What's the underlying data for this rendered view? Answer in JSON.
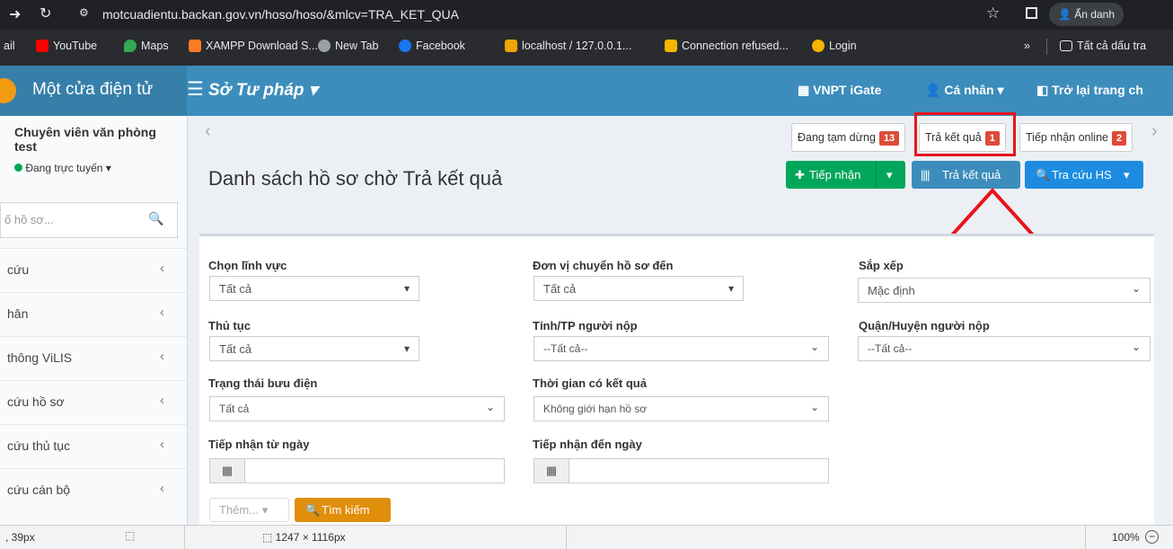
{
  "browser": {
    "url": "motcuadientu.backan.gov.vn/hoso/hoso/&mlcv=TRA_KET_QUA",
    "incognito_label": "Ẩn danh",
    "bookmarks": [
      {
        "label": "ail",
        "color": ""
      },
      {
        "label": "YouTube",
        "color": "#ff0000"
      },
      {
        "label": "Maps",
        "color": "#34a853"
      },
      {
        "label": "XAMPP Download S...",
        "color": "#fb7a24"
      },
      {
        "label": "New Tab",
        "color": "#9aa0a6"
      },
      {
        "label": "Facebook",
        "color": "#1877f2"
      },
      {
        "label": "localhost / 127.0.0.1...",
        "color": "#f0a30a"
      },
      {
        "label": "Connection refused...",
        "color": "#f4b400"
      },
      {
        "label": "Login",
        "color": "#f4b400"
      }
    ],
    "more_label": "»",
    "all_bookmarks_label": "Tất cả dấu tra"
  },
  "app": {
    "logo_text": "Một cửa điện tử",
    "department": "Sở Tư pháp",
    "nav": {
      "vnpt": "VNPT iGate",
      "personal": "Cá nhân",
      "back": "Trở lại trang ch"
    }
  },
  "user": {
    "name": "Chuyên viên văn phòng test",
    "status": "Đang trực tuyến"
  },
  "sidebar": {
    "search_placeholder": "ố hồ sơ...",
    "items": [
      {
        "label": "cứu"
      },
      {
        "label": "hân"
      },
      {
        "label": "thông ViLIS"
      },
      {
        "label": "cứu hồ sơ"
      },
      {
        "label": "cứu thủ tục"
      },
      {
        "label": "cứu cán bộ"
      }
    ]
  },
  "tabs": [
    {
      "label": "Đang tạm dừng",
      "count": "13"
    },
    {
      "label": "Trả kết quả",
      "count": "1"
    },
    {
      "label": "Tiếp nhận online",
      "count": "2"
    }
  ],
  "page": {
    "title": "Danh sách hồ sơ chờ Trả kết quả"
  },
  "actions": {
    "receive": "Tiếp nhận",
    "return": "Trả kết quả",
    "lookup": "Tra cứu HS"
  },
  "filters": {
    "field": {
      "label": "Chọn lĩnh vực",
      "value": "Tất cả"
    },
    "unit": {
      "label": "Đơn vị chuyển hồ sơ đến",
      "value": "Tất cả"
    },
    "sort": {
      "label": "Sắp xếp",
      "value": "Mặc định"
    },
    "procedure": {
      "label": "Thủ tục",
      "value": "Tất cả"
    },
    "province": {
      "label": "Tỉnh/TP người nộp",
      "value": "--Tất cả--"
    },
    "district": {
      "label": "Quận/Huyện người nộp",
      "value": "--Tất cả--"
    },
    "post_status": {
      "label": "Trạng thái bưu điện",
      "value": "Tất cả"
    },
    "result_time": {
      "label": "Thời gian có kết quả",
      "value": "Không giới hạn hồ sơ"
    },
    "from_date": {
      "label": "Tiếp nhận từ ngày"
    },
    "to_date": {
      "label": "Tiếp nhận đến ngày"
    },
    "more": "Thêm...",
    "search": "Tìm kiếm"
  },
  "status": {
    "coords": ", 39px",
    "dims": "1247 × 1116px",
    "zoom": "100%"
  },
  "colors": {
    "header": "#3c8dbc",
    "logo_bg": "#367fa9",
    "success": "#00a65a",
    "primary": "#3c8dbc",
    "danger": "#dd4b39",
    "warning": "#f39c12",
    "highlight": "#e8141c"
  }
}
